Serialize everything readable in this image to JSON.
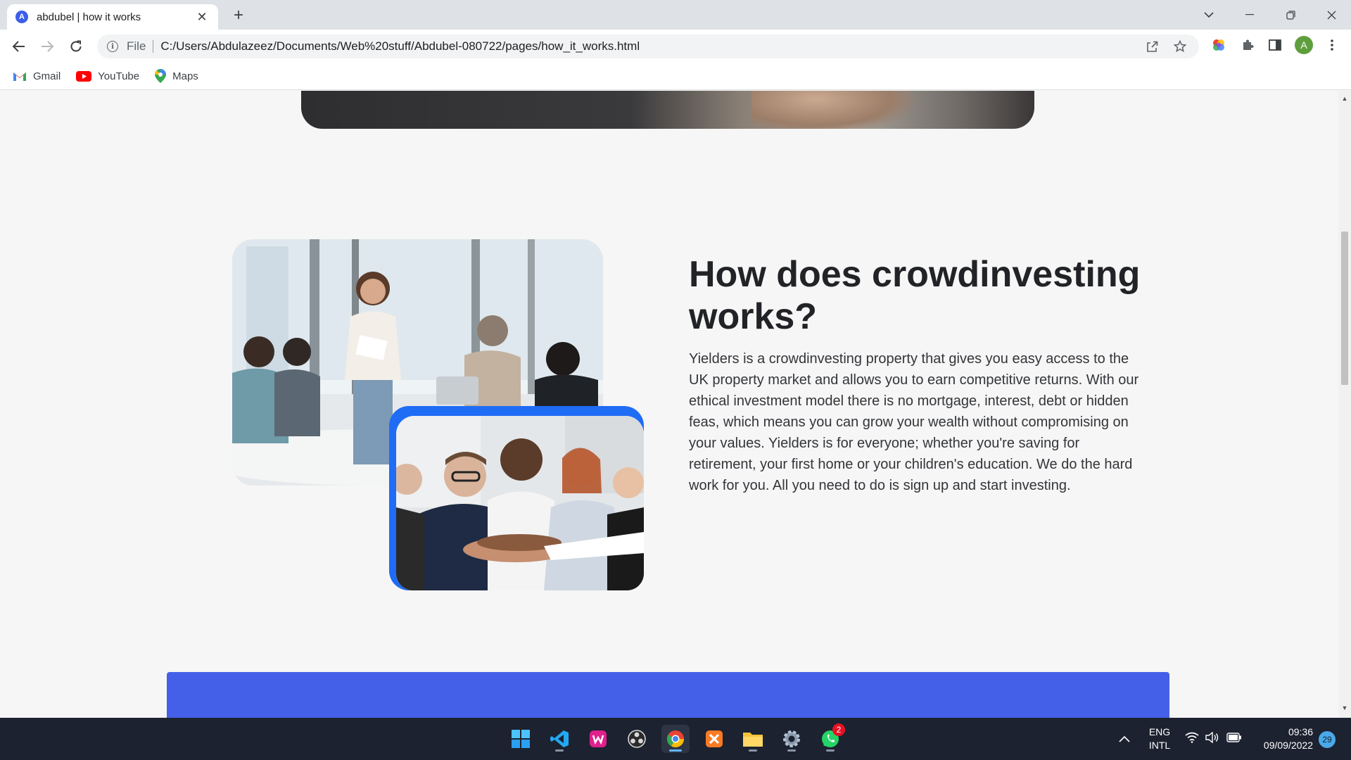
{
  "browser": {
    "tab_title": "abdubel | how it works",
    "favicon_letter": "A",
    "scheme_label": "File",
    "url": "C:/Users/Abdulazeez/Documents/Web%20stuff/Abdubel-080722/pages/how_it_works.html",
    "avatar_letter": "A",
    "bookmarks": [
      {
        "label": "Gmail",
        "icon": "gmail-icon"
      },
      {
        "label": "YouTube",
        "icon": "youtube-icon"
      },
      {
        "label": "Maps",
        "icon": "maps-icon"
      }
    ]
  },
  "page": {
    "section_title": "How does crowdinvesting works?",
    "section_body": "Yielders is a crowdinvesting property that gives you easy access to the UK property market and allows you to earn competitive returns. With our ethical investment model there is no mortgage, interest, debt or hidden feas, which means you can grow your wealth without compromising on your values. Yielders is for everyone; whether you're saving for retirement, your first home or your children's education. We do the hard work for you. All you need to do is sign up and start investing.",
    "accent_color": "#1f6cf5",
    "band_color": "#4560e8"
  },
  "taskbar": {
    "apps": [
      "windows-start-icon",
      "vscode-icon",
      "wamp-icon",
      "obs-icon",
      "chrome-icon",
      "xampp-icon",
      "file-explorer-icon",
      "settings-icon",
      "whatsapp-icon"
    ],
    "whatsapp_badge": "2",
    "language_top": "ENG",
    "language_bottom": "INTL",
    "time": "09:36",
    "date": "09/09/2022",
    "notification_count": "29"
  }
}
